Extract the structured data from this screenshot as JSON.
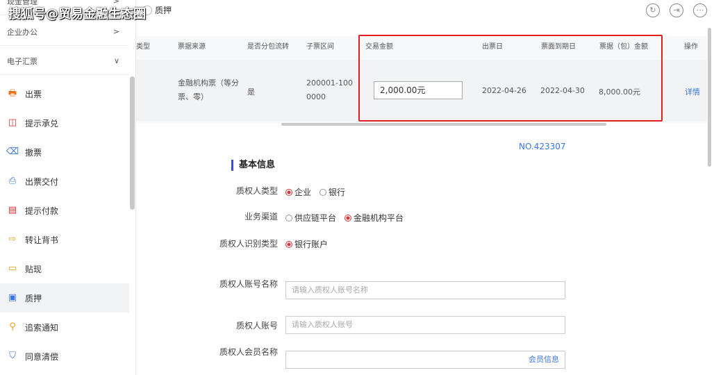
{
  "watermark": "搜狐号@贸易金融生态圈",
  "breadcrumb": {
    "current": "质押"
  },
  "sidebar": {
    "groups": [
      {
        "label": "现金管理",
        "chev": ">"
      },
      {
        "label": "企业办公",
        "chev": ">"
      },
      {
        "label": "电子汇票",
        "chev": "∨"
      }
    ],
    "items": [
      {
        "label": "出票",
        "icon": "🖶",
        "color": "#e8701a"
      },
      {
        "label": "提示承兑",
        "icon": "◫",
        "color": "#e03030"
      },
      {
        "label": "撤票",
        "icon": "⌫",
        "color": "#3a76e8"
      },
      {
        "label": "出票交付",
        "icon": "⎙",
        "color": "#3a76e8"
      },
      {
        "label": "提示付款",
        "icon": "▤",
        "color": "#e03030"
      },
      {
        "label": "转让背书",
        "icon": "⇨",
        "color": "#e8a01a"
      },
      {
        "label": "贴现",
        "icon": "▭",
        "color": "#e8a01a"
      },
      {
        "label": "质押",
        "icon": "▣",
        "color": "#3a76e8"
      },
      {
        "label": "追索通知",
        "icon": "⚲",
        "color": "#e8a01a"
      },
      {
        "label": "同意清偿",
        "icon": "⛉",
        "color": "#3a76e8"
      }
    ]
  },
  "table": {
    "headers": [
      "类型",
      "票据来源",
      "是否分包流转",
      "子票区间",
      "交易金额",
      "出票日",
      "票面到期日",
      "票据（包）金额",
      "操作"
    ],
    "row": {
      "source": "金融机构票（等分票、零）",
      "split": "是",
      "range": "200001-1000000",
      "amount": "2,000.00元",
      "issue_date": "2022-04-26",
      "due_date": "2022-04-30",
      "bill_amount": "8,000.00元",
      "action": "详情"
    }
  },
  "form": {
    "no": "NO.423307",
    "section": "基本信息",
    "pledgee_type_label": "质权人类型",
    "pledgee_type_opts": [
      "企业",
      "银行"
    ],
    "channel_label": "业务渠道",
    "channel_opts": [
      "供应链平台",
      "金融机构平台"
    ],
    "id_type_label": "质权人识别类型",
    "id_type_opts": [
      "银行账户"
    ],
    "acct_name_label": "质权人账号名称",
    "acct_name_placeholder": "请输入质权人账号名称",
    "acct_label": "质权人账号",
    "acct_placeholder": "请输入质权人账号",
    "member_label": "质权人会员名称",
    "member_link": "会员信息"
  }
}
